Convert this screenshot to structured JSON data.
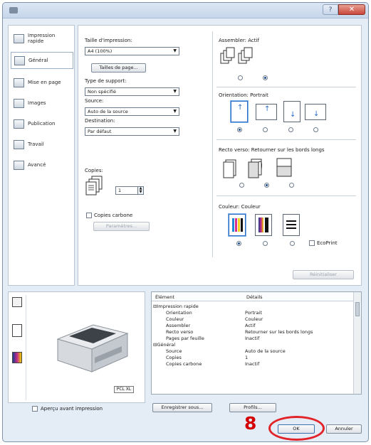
{
  "titlebar": {
    "help_glyph": "?",
    "close_glyph": "✕"
  },
  "nav": {
    "items": [
      {
        "label": "Impression rapide",
        "icon": "quick-print-icon"
      },
      {
        "label": "Général",
        "icon": "general-icon",
        "selected": true
      },
      {
        "label": "Mise en page",
        "icon": "layout-icon"
      },
      {
        "label": "Images",
        "icon": "images-icon"
      },
      {
        "label": "Publication",
        "icon": "publication-icon"
      },
      {
        "label": "Travail",
        "icon": "job-icon"
      },
      {
        "label": "Avancé",
        "icon": "advanced-icon"
      }
    ]
  },
  "general": {
    "print_size_label": "Taille d'impression:",
    "print_size_value": "A4 (100%)",
    "page_sizes_button": "Tailles de page...",
    "media_type_label": "Type de support:",
    "media_type_value": "Non spécifié",
    "source_label": "Source:",
    "source_value": "Auto de la source",
    "destination_label": "Destination:",
    "destination_value": "Par défaut",
    "copies_label": "Copies:",
    "copies_value": "1",
    "carbon_copies_label": "Copies carbone",
    "settings_button": "Paramètres...",
    "collate_label": "Assembler: Actif",
    "orientation_label": "Orientation: Portrait",
    "duplex_label": "Recto verso: Retourner sur les bords longs",
    "color_label": "Couleur: Couleur",
    "ecoprint_label": "EcoPrint",
    "reset_button": "Réinitialiser"
  },
  "preview": {
    "pcl_badge": "PCL XL",
    "preview_checkbox_label": "Aperçu avant impression"
  },
  "details": {
    "col_element": "Élément",
    "col_details": "Détails",
    "rows": [
      {
        "element": "Impression rapide",
        "detail": "",
        "group": true
      },
      {
        "element": "Orientation",
        "detail": "Portrait"
      },
      {
        "element": "Couleur",
        "detail": "Couleur"
      },
      {
        "element": "Assembler",
        "detail": "Actif"
      },
      {
        "element": "Recto verso",
        "detail": "Retourner sur les bords longs"
      },
      {
        "element": "Pages par feuille",
        "detail": "Inactif"
      },
      {
        "element": "Général",
        "detail": "",
        "group": true
      },
      {
        "element": "Source",
        "detail": "Auto de la source"
      },
      {
        "element": "Copies",
        "detail": "1"
      },
      {
        "element": "Copies carbone",
        "detail": "Inactif"
      }
    ]
  },
  "footer": {
    "save_as_button": "Enregistrer sous...",
    "profiles_button": "Profils...",
    "ok_button": "OK",
    "cancel_button": "Annuler",
    "step_number": "8"
  },
  "colors": {
    "highlight_red": "#e2242a",
    "accent_blue": "#2b6cc4"
  }
}
